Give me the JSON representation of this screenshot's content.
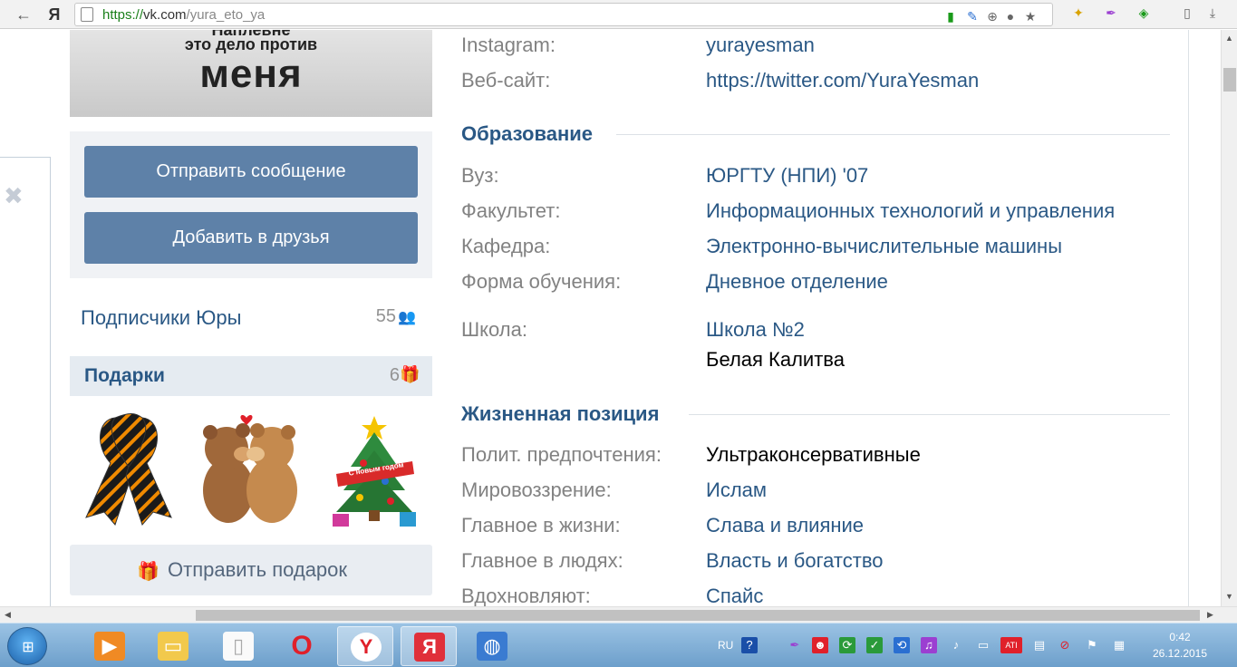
{
  "browser": {
    "back_icon": "←",
    "yandex_logo": "Я",
    "url_scheme": "https://",
    "url_host": "vk.com",
    "url_path": "/yura_eto_ya",
    "icons": [
      "lock-icon",
      "pen-icon",
      "zoom-icon",
      "bulb-icon",
      "star-icon"
    ],
    "ext_icons": [
      "translate-icon",
      "feather-icon",
      "shield-icon"
    ],
    "right_icons": [
      "page-icon",
      "download-icon"
    ]
  },
  "avatar": {
    "line1": "Наплевне",
    "line2": "это дело против",
    "line3": "меня"
  },
  "actions": {
    "message": "Отправить сообщение",
    "add_friend": "Добавить в друзья"
  },
  "followers": {
    "label": "Подписчики Юры",
    "count": "55"
  },
  "gifts": {
    "label": "Подарки",
    "count": "6",
    "items": [
      "ribbon-gift",
      "bears-gift",
      "tree-gift"
    ],
    "tree_banner": "С новым годом",
    "send_label": "Отправить подарок"
  },
  "contacts": {
    "instagram_key": "Instagram:",
    "instagram_val": "yurayesman",
    "site_key": "Веб-сайт:",
    "site_val": "https://twitter.com/YuraYesman"
  },
  "education": {
    "title": "Образование",
    "uni_key": "Вуз:",
    "uni_val": "ЮРГТУ (НПИ) '07",
    "faculty_key": "Факультет:",
    "faculty_val": "Информационных технологий и управления",
    "dept_key": "Кафедра:",
    "dept_val": "Электронно-вычислительные машины",
    "form_key": "Форма обучения:",
    "form_val": "Дневное отделение",
    "school_key": "Школа:",
    "school_val": "Школа №2",
    "school_city": "Белая Калитва"
  },
  "life_position": {
    "title": "Жизненная позиция",
    "politics_key": "Полит. предпочтения:",
    "politics_val": "Ультраконсервативные",
    "world_key": "Мировоззрение:",
    "world_val": "Ислам",
    "main_life_key": "Главное в жизни:",
    "main_life_val": "Слава и влияние",
    "main_people_key": "Главное в людях:",
    "main_people_val": "Власть и богатство",
    "inspire_key": "Вдохновляют:",
    "inspire_val": "Спайс"
  },
  "taskbar": {
    "apps": [
      "media-player",
      "file-explorer",
      "notepad",
      "opera",
      "yandex-browser",
      "yandex",
      "network-app"
    ],
    "lang": "RU",
    "time": "0:42",
    "date": "26.12.2015"
  },
  "colors": {
    "vk_blue": "#2a5885",
    "button_blue": "#5e81a8",
    "label_gray": "#828282"
  }
}
